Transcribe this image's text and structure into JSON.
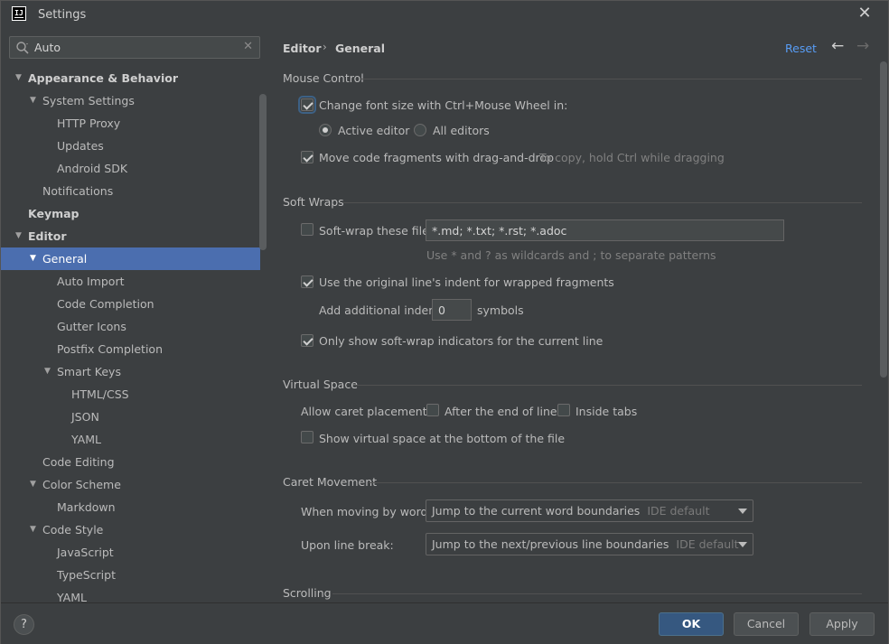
{
  "window": {
    "title": "Settings",
    "app_icon_text": "IJ"
  },
  "search": {
    "value": "Auto",
    "placeholder": ""
  },
  "tree": [
    {
      "label": "Appearance & Behavior",
      "level": 0,
      "arrow": "down",
      "bold": true
    },
    {
      "label": "System Settings",
      "level": 1,
      "arrow": "down"
    },
    {
      "label": "HTTP Proxy",
      "level": 2
    },
    {
      "label": "Updates",
      "level": 2
    },
    {
      "label": "Android SDK",
      "level": 2
    },
    {
      "label": "Notifications",
      "level": 1
    },
    {
      "label": "Keymap",
      "level": 0,
      "bold": true
    },
    {
      "label": "Editor",
      "level": 0,
      "arrow": "down",
      "bold": true
    },
    {
      "label": "General",
      "level": 1,
      "arrow": "down",
      "selected": true
    },
    {
      "label": "Auto Import",
      "level": 2
    },
    {
      "label": "Code Completion",
      "level": 2
    },
    {
      "label": "Gutter Icons",
      "level": 2
    },
    {
      "label": "Postfix Completion",
      "level": 2
    },
    {
      "label": "Smart Keys",
      "level": 2,
      "arrow": "down"
    },
    {
      "label": "HTML/CSS",
      "level": 3
    },
    {
      "label": "JSON",
      "level": 3
    },
    {
      "label": "YAML",
      "level": 3
    },
    {
      "label": "Code Editing",
      "level": 1
    },
    {
      "label": "Color Scheme",
      "level": 1,
      "arrow": "down"
    },
    {
      "label": "Markdown",
      "level": 2
    },
    {
      "label": "Code Style",
      "level": 1,
      "arrow": "down"
    },
    {
      "label": "JavaScript",
      "level": 2
    },
    {
      "label": "TypeScript",
      "level": 2
    },
    {
      "label": "YAML",
      "level": 2
    }
  ],
  "header": {
    "crumb_1": "Editor",
    "crumb_sep": "›",
    "crumb_2": "General",
    "reset": "Reset",
    "back": "←",
    "forward": "→"
  },
  "mouse_control": {
    "title": "Mouse Control",
    "change_font": "Change font size with Ctrl+Mouse Wheel in:",
    "change_font_checked": true,
    "active_editor": "Active editor",
    "all_editors": "All editors",
    "selected_scope": "active",
    "drag_drop": "Move code fragments with drag-and-drop",
    "drag_drop_checked": true,
    "drag_drop_hint": "To copy, hold Ctrl while dragging"
  },
  "soft_wraps": {
    "title": "Soft Wraps",
    "soft_wrap_files": "Soft-wrap these files:",
    "soft_wrap_files_checked": false,
    "patterns": "*.md; *.txt; *.rst; *.adoc",
    "patterns_hint": "Use * and ? as wildcards and ; to separate patterns",
    "original_indent": "Use the original line's indent for wrapped fragments",
    "original_indent_checked": true,
    "additional_indent": "Add additional indent:",
    "additional_indent_value": "0",
    "symbols": "symbols",
    "only_show_indicators": "Only show soft-wrap indicators for the current line",
    "only_show_indicators_checked": true
  },
  "virtual_space": {
    "title": "Virtual Space",
    "caret_placement": "Allow caret placement:",
    "after_end": "After the end of line",
    "after_end_checked": false,
    "inside_tabs": "Inside tabs",
    "inside_tabs_checked": false,
    "show_bottom": "Show virtual space at the bottom of the file",
    "show_bottom_checked": false
  },
  "caret_movement": {
    "title": "Caret Movement",
    "moving_words": "When moving by words:",
    "moving_words_value": "Jump to the current word boundaries",
    "moving_words_sub": "IDE default",
    "line_break": "Upon line break:",
    "line_break_value": "Jump to the next/previous line boundaries",
    "line_break_sub": "IDE default"
  },
  "scrolling": {
    "title": "Scrolling"
  },
  "footer": {
    "help": "?",
    "ok": "OK",
    "cancel": "Cancel",
    "apply": "Apply"
  },
  "colors": {
    "accent": "#4b6eaf",
    "link": "#589df6",
    "primary_button": "#365880",
    "background": "#3c3f41"
  }
}
